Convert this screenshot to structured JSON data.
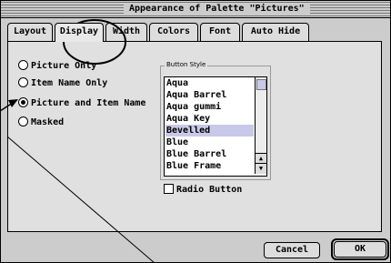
{
  "window": {
    "title": "Appearance of Palette \"Pictures\""
  },
  "tabs": [
    {
      "label": "Layout"
    },
    {
      "label": "Display"
    },
    {
      "label": "Width"
    },
    {
      "label": "Colors"
    },
    {
      "label": "Font"
    },
    {
      "label": "Auto Hide"
    }
  ],
  "options": [
    {
      "label": "Picture Only",
      "selected": false
    },
    {
      "label": "Item Name Only",
      "selected": false
    },
    {
      "label": "Picture and Item Name",
      "selected": true
    },
    {
      "label": "Masked",
      "selected": false
    }
  ],
  "button_style": {
    "group_label": "Button Style",
    "items": [
      "Aqua",
      "Aqua Barrel",
      "Aqua gummi",
      "Aqua Key",
      "Bevelled",
      "Blue",
      "Blue Barrel",
      "Blue Frame"
    ],
    "selected": "Bevelled"
  },
  "radio_button_checkbox": {
    "label": "Radio Button",
    "checked": false
  },
  "buttons": {
    "cancel": "Cancel",
    "ok": "OK"
  },
  "icons": [
    "scroll-up-arrow-icon",
    "scroll-down-arrow-icon",
    "callout-arrow-icon"
  ]
}
